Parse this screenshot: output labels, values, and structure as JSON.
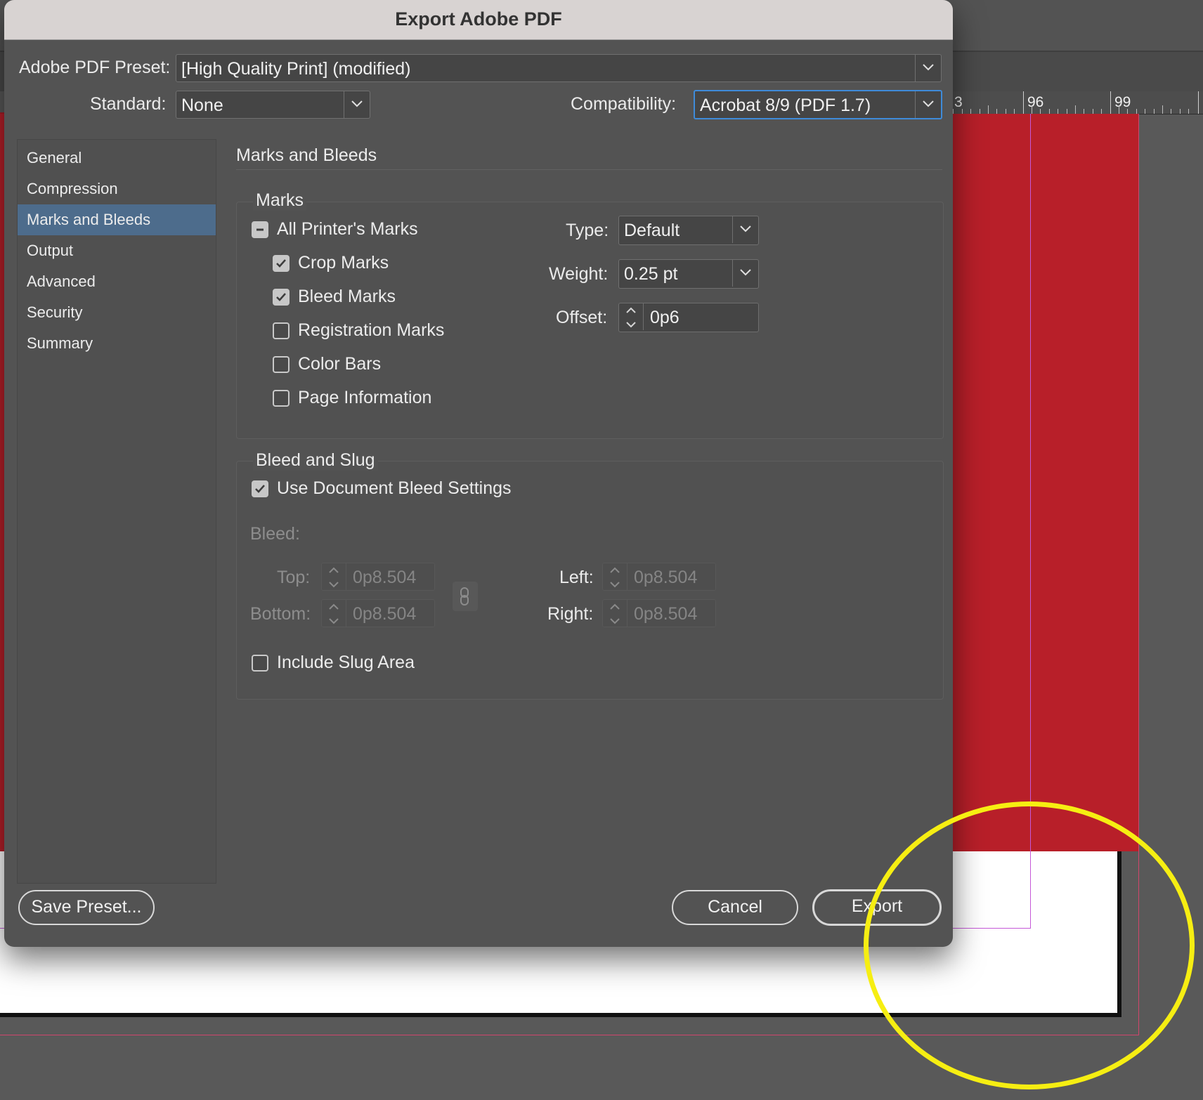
{
  "dialog": {
    "title": "Export Adobe PDF",
    "preset_label": "Adobe PDF Preset:",
    "preset_value": "[High Quality Print] (modified)",
    "standard_label": "Standard:",
    "standard_value": "None",
    "compatibility_label": "Compatibility:",
    "compatibility_value": "Acrobat 8/9 (PDF 1.7)"
  },
  "nav": {
    "items": [
      {
        "label": "General"
      },
      {
        "label": "Compression"
      },
      {
        "label": "Marks and Bleeds",
        "selected": true
      },
      {
        "label": "Output"
      },
      {
        "label": "Advanced"
      },
      {
        "label": "Security"
      },
      {
        "label": "Summary"
      }
    ]
  },
  "section": {
    "title": "Marks and Bleeds"
  },
  "marks": {
    "group_title": "Marks",
    "all_printers_marks": {
      "label": "All Printer's Marks",
      "state": "mixed"
    },
    "crop_marks": {
      "label": "Crop Marks",
      "checked": true
    },
    "bleed_marks": {
      "label": "Bleed Marks",
      "checked": true
    },
    "registration_marks": {
      "label": "Registration Marks",
      "checked": false
    },
    "color_bars": {
      "label": "Color Bars",
      "checked": false
    },
    "page_information": {
      "label": "Page Information",
      "checked": false
    },
    "type_label": "Type:",
    "type_value": "Default",
    "weight_label": "Weight:",
    "weight_value": "0.25 pt",
    "offset_label": "Offset:",
    "offset_value": "0p6"
  },
  "bleed": {
    "group_title": "Bleed and Slug",
    "use_document_bleed": {
      "label": "Use Document Bleed Settings",
      "checked": true
    },
    "bleed_label": "Bleed:",
    "top_label": "Top:",
    "top_value": "0p8.504",
    "bottom_label": "Bottom:",
    "bottom_value": "0p8.504",
    "left_label": "Left:",
    "left_value": "0p8.504",
    "right_label": "Right:",
    "right_value": "0p8.504",
    "include_slug": {
      "label": "Include Slug Area",
      "checked": false
    }
  },
  "buttons": {
    "save_preset": "Save Preset...",
    "cancel": "Cancel",
    "export": "Export"
  },
  "ruler": {
    "labels": [
      "3",
      "96",
      "99"
    ]
  },
  "colors": {
    "page_red": "#b81f29",
    "annotation_yellow": "#f6ee12",
    "selection_blue": "#4d6c8c",
    "focus_blue": "#3f8bd9"
  }
}
